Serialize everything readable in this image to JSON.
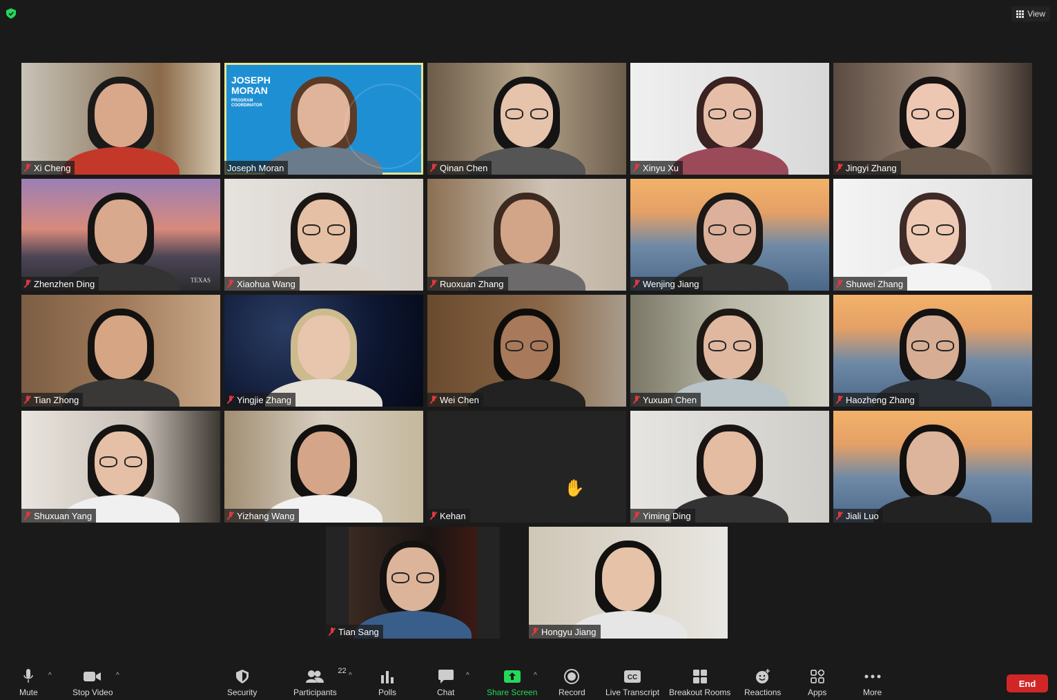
{
  "top": {
    "view_label": "View"
  },
  "participants": [
    {
      "name": "Xi Cheng"
    },
    {
      "name": "Joseph Moran",
      "active": true,
      "banner": {
        "line1": "JOSEPH",
        "line2": "MORAN",
        "sub1": "PROGRAM",
        "sub2": "COORDINATOR"
      }
    },
    {
      "name": "Qinan Chen"
    },
    {
      "name": "Xinyu Xu"
    },
    {
      "name": "Jingyi Zhang"
    },
    {
      "name": "Zhenzhen Ding",
      "watermark": "TEXAS"
    },
    {
      "name": "Xiaohua Wang"
    },
    {
      "name": "Ruoxuan Zhang"
    },
    {
      "name": "Wenjing Jiang"
    },
    {
      "name": "Shuwei Zhang"
    },
    {
      "name": "Tian Zhong"
    },
    {
      "name": "Yingjie Zhang"
    },
    {
      "name": "Wei Chen"
    },
    {
      "name": "Yuxuan Chen"
    },
    {
      "name": "Haozheng Zhang"
    },
    {
      "name": "Shuxuan Yang"
    },
    {
      "name": "Yizhang Wang"
    },
    {
      "name": "Kehan",
      "video_off": true,
      "hand_raised": true
    },
    {
      "name": "Yiming Ding"
    },
    {
      "name": "Jiali Luo"
    },
    {
      "name": "Tian Sang"
    },
    {
      "name": "Hongyu Jiang"
    }
  ],
  "toolbar": {
    "mute": "Mute",
    "stop_video": "Stop Video",
    "security": "Security",
    "participants": "Participants",
    "participant_count": "22",
    "polls": "Polls",
    "chat": "Chat",
    "share_screen": "Share Screen",
    "record": "Record",
    "live_transcript": "Live Transcript",
    "breakout_rooms": "Breakout Rooms",
    "reactions": "Reactions",
    "apps": "Apps",
    "more": "More",
    "end": "End"
  },
  "colors": {
    "accent_green": "#23d959",
    "end_red": "#d12626",
    "muted_red": "#e0383e",
    "active_speaker": "#e6e690"
  }
}
